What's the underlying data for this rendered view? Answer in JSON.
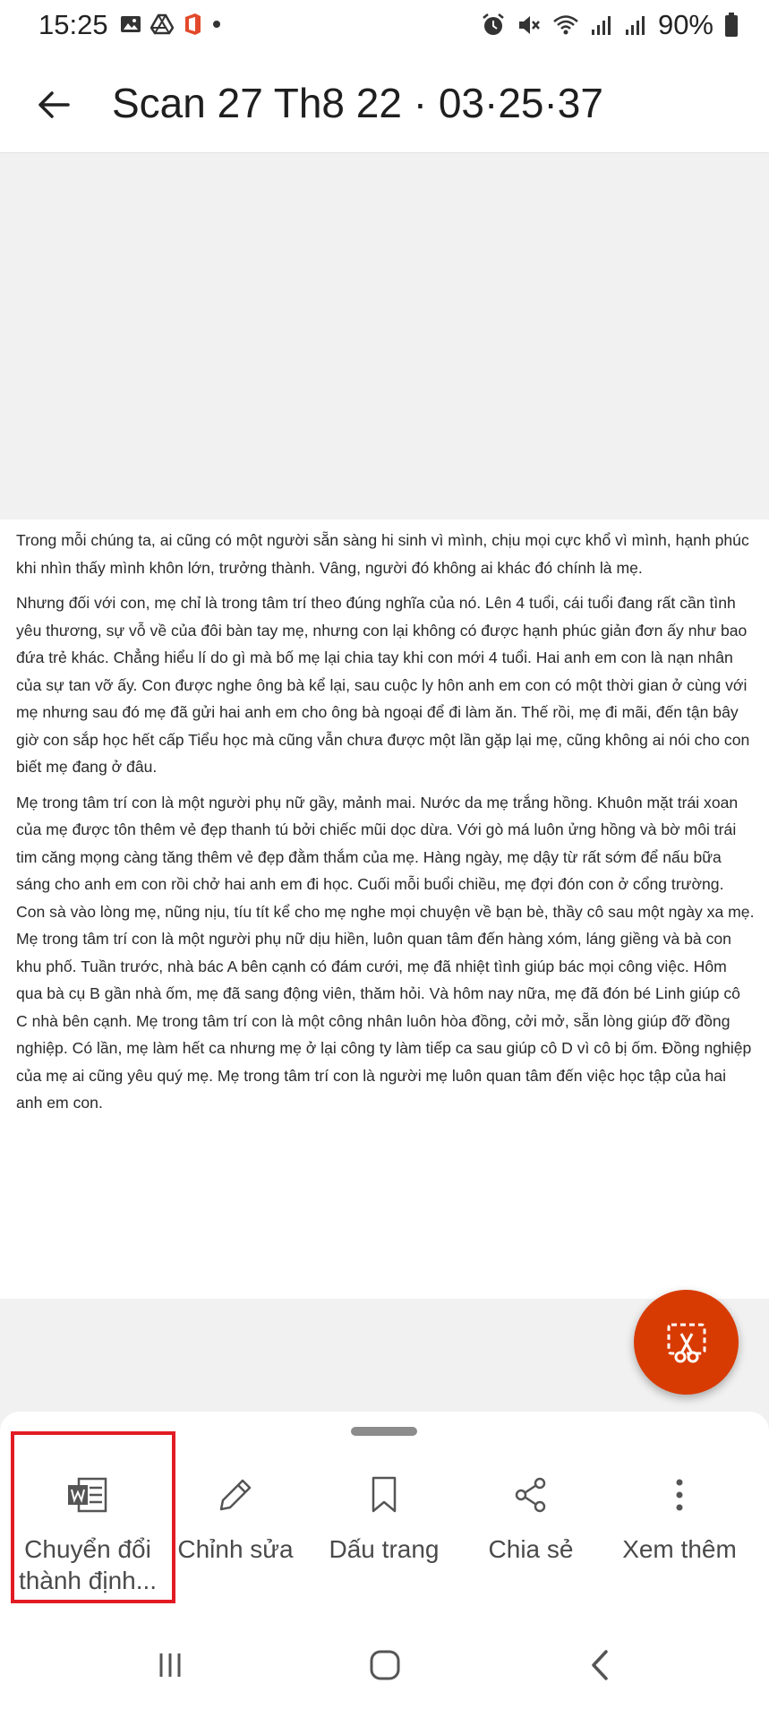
{
  "status_bar": {
    "time": "15:25",
    "battery": "90%",
    "left_icons": [
      "image-icon",
      "drive-icon",
      "office-icon",
      "dot-icon"
    ],
    "right_icons": [
      "alarm-icon",
      "mute-icon",
      "wifi-icon",
      "signal-icon",
      "signal-icon",
      "battery-icon"
    ]
  },
  "app_bar": {
    "title": "Scan 27 Th8 22 · 03·25·37"
  },
  "document": {
    "paragraphs": [
      "Trong mỗi chúng ta, ai cũng có một người sẵn sàng hi sinh vì mình, chịu mọi cực khổ vì mình, hạnh phúc khi nhìn thấy mình khôn lớn, trưởng thành. Vâng, người đó không ai khác đó chính là mẹ.",
      "Nhưng đối với con, mẹ chỉ là trong tâm trí theo đúng nghĩa của nó. Lên 4 tuổi, cái tuổi đang rất cần tình yêu thương, sự vỗ về của đôi bàn tay mẹ, nhưng con lại không có được hạnh phúc giản đơn ấy như bao đứa trẻ khác. Chẳng hiểu lí do gì mà bố mẹ lại chia tay khi con mới 4 tuổi. Hai anh em con là nạn nhân của sự tan vỡ ấy. Con được nghe ông bà kể lại, sau cuộc ly hôn anh em con có một thời gian ở cùng với mẹ nhưng sau đó mẹ đã gửi hai anh em cho ông bà ngoại để đi làm ăn. Thế rồi, mẹ đi mãi, đến tận bây giờ con sắp học hết cấp Tiểu học mà cũng vẫn chưa được một lần gặp lại mẹ, cũng không ai nói cho con biết mẹ đang ở đâu.",
      "Mẹ trong tâm trí con là một người phụ nữ gầy, mảnh mai. Nước da mẹ trắng hồng. Khuôn mặt trái xoan của mẹ được tôn thêm vẻ đẹp thanh tú bởi chiếc mũi dọc dừa. Với gò má luôn ửng hồng và bờ môi trái tim căng mọng càng tăng thêm vẻ đẹp đằm thắm của mẹ. Hàng ngày, mẹ dậy từ rất sớm để nấu bữa sáng cho anh em con rồi chở hai anh em đi học. Cuối mỗi buổi chiều, mẹ đợi đón con ở cổng trường. Con sà vào lòng mẹ, nũng nịu, tíu tít kể cho mẹ nghe mọi chuyện về bạn bè, thầy cô sau một ngày xa mẹ. Mẹ trong tâm trí con là một người phụ nữ dịu hiền, luôn quan tâm đến hàng xóm, láng giềng và bà con khu phố. Tuần trước, nhà bác A bên cạnh có đám cưới, mẹ đã nhiệt tình giúp bác mọi công việc. Hôm qua bà cụ B gần nhà ốm, mẹ đã sang động viên, thăm hỏi. Và hôm nay nữa, mẹ đã đón bé Linh giúp cô C nhà bên cạnh. Mẹ trong tâm trí con là một công nhân luôn hòa đồng, cởi mở, sẵn lòng giúp đỡ đồng nghiệp. Có lần, mẹ làm hết ca nhưng mẹ ở lại công ty làm tiếp ca sau giúp cô D vì cô bị ốm. Đồng nghiệp của mẹ ai cũng yêu quý mẹ. Mẹ trong tâm trí con là người mẹ luôn quan tâm đến việc học tập của hai anh em con."
    ]
  },
  "fab": {
    "icon": "crop-scissors-icon",
    "color": "#d83b01"
  },
  "actions": [
    {
      "icon": "word-convert-icon",
      "label": "Chuyển đổi thành định..."
    },
    {
      "icon": "pencil-icon",
      "label": "Chỉnh sửa"
    },
    {
      "icon": "bookmark-icon",
      "label": "Dấu trang"
    },
    {
      "icon": "share-icon",
      "label": "Chia sẻ"
    },
    {
      "icon": "more-vertical-icon",
      "label": "Xem thêm"
    }
  ],
  "highlight_color": "#e21b23",
  "nav_bar": [
    "recent-apps-icon",
    "home-icon",
    "back-icon"
  ]
}
